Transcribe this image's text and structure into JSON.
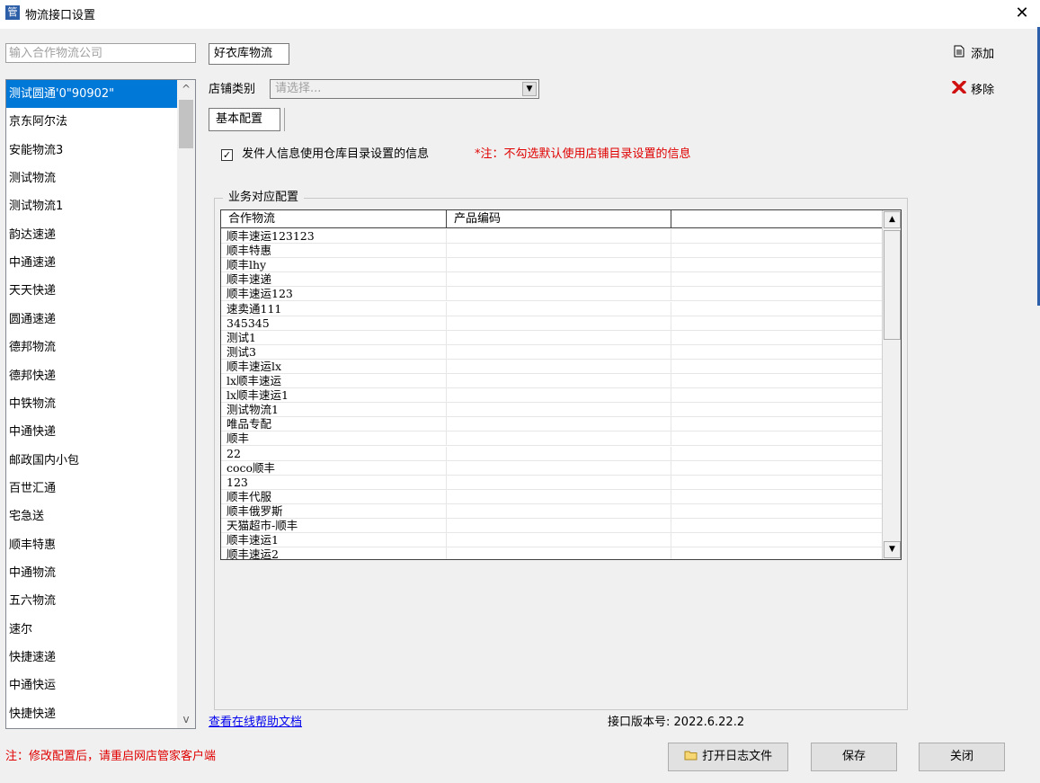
{
  "window": {
    "title": "物流接口设置",
    "icon": "app-logo-icon",
    "close_glyph": "✕"
  },
  "search": {
    "placeholder": "输入合作物流公司"
  },
  "logistics_list": {
    "selected_index": 0,
    "items": [
      "测试圆通'0\"90902\"",
      "京东阿尔法",
      "安能物流3",
      "测试物流",
      "测试物流1",
      "韵达速递",
      "中通速递",
      "天天快递",
      "圆通速递",
      "德邦物流",
      "德邦快递",
      "中铁物流",
      "中通快递",
      "邮政国内小包",
      "百世汇通",
      "宅急送",
      "顺丰特惠",
      "中通物流",
      "五六物流",
      "速尔",
      "快捷速递",
      "中通快运",
      "快捷快递"
    ]
  },
  "shop_tab": {
    "label": "好衣库物流"
  },
  "actions": {
    "add_label": "添加",
    "add_icon": "document-icon",
    "remove_label": "移除",
    "remove_icon": "red-x-icon"
  },
  "store_type": {
    "label": "店铺类别",
    "placeholder": "请选择..."
  },
  "config_tab": {
    "label": "基本配置"
  },
  "sender_option": {
    "checked": true,
    "label": "发件人信息使用仓库目录设置的信息",
    "note": "*注：不勾选默认使用店铺目录设置的信息"
  },
  "business_config": {
    "group_label": "业务对应配置",
    "columns": [
      "合作物流",
      "产品编码",
      ""
    ],
    "rows": [
      [
        "顺丰速运123123",
        "",
        ""
      ],
      [
        "顺丰特惠",
        "",
        ""
      ],
      [
        "顺丰lhy",
        "",
        ""
      ],
      [
        "顺丰速递",
        "",
        ""
      ],
      [
        "顺丰速运123",
        "",
        ""
      ],
      [
        "速卖通111",
        "",
        ""
      ],
      [
        "345345",
        "",
        ""
      ],
      [
        "测试1",
        "",
        ""
      ],
      [
        "测试3",
        "",
        ""
      ],
      [
        "顺丰速运lx",
        "",
        ""
      ],
      [
        "lx顺丰速运",
        "",
        ""
      ],
      [
        "lx顺丰速运1",
        "",
        ""
      ],
      [
        "测试物流1",
        "",
        ""
      ],
      [
        "唯品专配",
        "",
        ""
      ],
      [
        "顺丰",
        "",
        ""
      ],
      [
        "22",
        "",
        ""
      ],
      [
        "coco顺丰",
        "",
        ""
      ],
      [
        "123",
        "",
        ""
      ],
      [
        "顺丰代服",
        "",
        ""
      ],
      [
        "顺丰俄罗斯",
        "",
        ""
      ],
      [
        "天猫超市-顺丰",
        "",
        ""
      ],
      [
        "顺丰速运1",
        "",
        ""
      ],
      [
        "顺丰速运2",
        "",
        ""
      ]
    ]
  },
  "footer": {
    "help_link": "查看在线帮助文档",
    "version_label": "接口版本号:",
    "version": "2022.6.22.2",
    "restart_note": "注：修改配置后，请重启网店管家客户端",
    "open_log_label": "打开日志文件",
    "open_log_icon": "folder-icon",
    "save_label": "保存",
    "close_label": "关闭"
  },
  "colors": {
    "selection": "#0078d7",
    "warning_text": "#e00000",
    "link": "#0000ee",
    "window_bg": "#f0f0f0"
  }
}
